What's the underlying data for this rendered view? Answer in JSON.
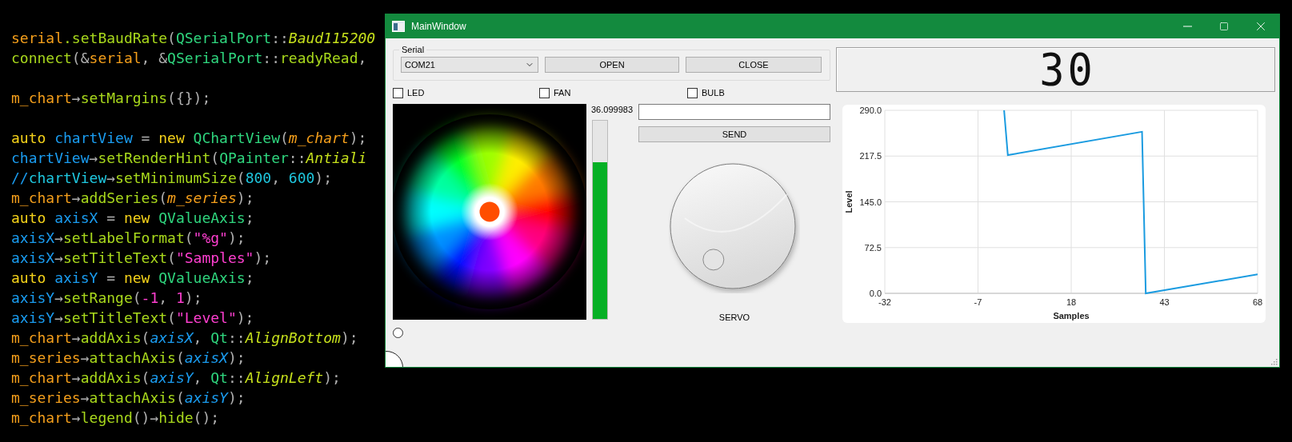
{
  "code_editor": {
    "lines": [
      {
        "kind": "code",
        "segments": [
          {
            "text": "serial",
            "color": "#f59f1b"
          },
          {
            "text": ".setBaudRate",
            "color": "#a8d81c"
          },
          {
            "text": "(",
            "color": "#b0b0b0"
          },
          {
            "text": "QSerialPort",
            "color": "#2fd67e"
          },
          {
            "text": "::",
            "color": "#b0b0b0"
          },
          {
            "text": "*Baud115200*",
            "color": "#c6e01c"
          }
        ]
      },
      {
        "kind": "code",
        "segments": [
          {
            "text": "connect",
            "color": "#a8d81c"
          },
          {
            "text": "(&",
            "color": "#b0b0b0"
          },
          {
            "text": "serial",
            "color": "#f59f1b"
          },
          {
            "text": ", &",
            "color": "#b0b0b0"
          },
          {
            "text": "QSerialPort",
            "color": "#2fd67e"
          },
          {
            "text": "::",
            "color": "#b0b0b0"
          },
          {
            "text": "readyRead",
            "color": "#a8d81c"
          },
          {
            "text": ",",
            "color": "#b0b0b0"
          }
        ]
      },
      {
        "kind": "blank"
      },
      {
        "kind": "code",
        "segments": [
          {
            "text": "m_chart",
            "color": "#f59f1b"
          },
          {
            "text": "→",
            "color": "#b0b0b0"
          },
          {
            "text": "setMargins",
            "color": "#a8d81c"
          },
          {
            "text": "({});",
            "color": "#b0b0b0"
          }
        ]
      },
      {
        "kind": "blank"
      },
      {
        "kind": "code",
        "segments": [
          {
            "text": "auto ",
            "color": "#f5d21a"
          },
          {
            "text": "chartView",
            "color": "#1a9cf0"
          },
          {
            "text": " = ",
            "color": "#b0b0b0"
          },
          {
            "text": "new ",
            "color": "#f5d21a"
          },
          {
            "text": "QChartView",
            "color": "#2fd67e"
          },
          {
            "text": "(",
            "color": "#b0b0b0"
          },
          {
            "text": "*m_chart*",
            "color": "#f59f1b"
          },
          {
            "text": ");",
            "color": "#b0b0b0"
          }
        ]
      },
      {
        "kind": "code",
        "segments": [
          {
            "text": "chartView",
            "color": "#1a9cf0"
          },
          {
            "text": "→",
            "color": "#b0b0b0"
          },
          {
            "text": "setRenderHint",
            "color": "#a8d81c"
          },
          {
            "text": "(",
            "color": "#b0b0b0"
          },
          {
            "text": "QPainter",
            "color": "#2fd67e"
          },
          {
            "text": "::",
            "color": "#b0b0b0"
          },
          {
            "text": "*Antiali*",
            "color": "#c6e01c"
          }
        ]
      },
      {
        "kind": "code",
        "segments": [
          {
            "text": "//",
            "color": "#1a9cf0"
          },
          {
            "text": "chartView",
            "color": "#1fc8e0"
          },
          {
            "text": "→",
            "color": "#b0b0b0"
          },
          {
            "text": "setMinimumSize",
            "color": "#a8d81c"
          },
          {
            "text": "(",
            "color": "#b0b0b0"
          },
          {
            "text": "800",
            "color": "#1fc8e0"
          },
          {
            "text": ", ",
            "color": "#b0b0b0"
          },
          {
            "text": "600",
            "color": "#1fc8e0"
          },
          {
            "text": ");",
            "color": "#b0b0b0"
          }
        ]
      },
      {
        "kind": "code",
        "segments": [
          {
            "text": "m_chart",
            "color": "#f59f1b"
          },
          {
            "text": "→",
            "color": "#b0b0b0"
          },
          {
            "text": "addSeries",
            "color": "#a8d81c"
          },
          {
            "text": "(",
            "color": "#b0b0b0"
          },
          {
            "text": "*m_series*",
            "color": "#f59f1b"
          },
          {
            "text": ");",
            "color": "#b0b0b0"
          }
        ]
      },
      {
        "kind": "code",
        "segments": [
          {
            "text": "auto ",
            "color": "#f5d21a"
          },
          {
            "text": "axisX",
            "color": "#1a9cf0"
          },
          {
            "text": " = ",
            "color": "#b0b0b0"
          },
          {
            "text": "new ",
            "color": "#f5d21a"
          },
          {
            "text": "QValueAxis",
            "color": "#2fd67e"
          },
          {
            "text": ";",
            "color": "#b0b0b0"
          }
        ]
      },
      {
        "kind": "code",
        "segments": [
          {
            "text": "axisX",
            "color": "#1a9cf0"
          },
          {
            "text": "→",
            "color": "#b0b0b0"
          },
          {
            "text": "setLabelFormat",
            "color": "#a8d81c"
          },
          {
            "text": "(",
            "color": "#b0b0b0"
          },
          {
            "text": "\"%g\"",
            "color": "#ff3fd0"
          },
          {
            "text": ");",
            "color": "#b0b0b0"
          }
        ]
      },
      {
        "kind": "code",
        "segments": [
          {
            "text": "axisX",
            "color": "#1a9cf0"
          },
          {
            "text": "→",
            "color": "#b0b0b0"
          },
          {
            "text": "setTitleText",
            "color": "#a8d81c"
          },
          {
            "text": "(",
            "color": "#b0b0b0"
          },
          {
            "text": "\"Samples\"",
            "color": "#ff3fd0"
          },
          {
            "text": ");",
            "color": "#b0b0b0"
          }
        ]
      },
      {
        "kind": "code",
        "segments": [
          {
            "text": "auto ",
            "color": "#f5d21a"
          },
          {
            "text": "axisY",
            "color": "#1a9cf0"
          },
          {
            "text": " = ",
            "color": "#b0b0b0"
          },
          {
            "text": "new ",
            "color": "#f5d21a"
          },
          {
            "text": "QValueAxis",
            "color": "#2fd67e"
          },
          {
            "text": ";",
            "color": "#b0b0b0"
          }
        ]
      },
      {
        "kind": "code",
        "segments": [
          {
            "text": "axisY",
            "color": "#1a9cf0"
          },
          {
            "text": "→",
            "color": "#b0b0b0"
          },
          {
            "text": "setRange",
            "color": "#a8d81c"
          },
          {
            "text": "(",
            "color": "#b0b0b0"
          },
          {
            "text": "-1",
            "color": "#ff3fd0"
          },
          {
            "text": ", ",
            "color": "#b0b0b0"
          },
          {
            "text": "1",
            "color": "#ff3fd0"
          },
          {
            "text": ");",
            "color": "#b0b0b0"
          }
        ]
      },
      {
        "kind": "code",
        "segments": [
          {
            "text": "axisY",
            "color": "#1a9cf0"
          },
          {
            "text": "→",
            "color": "#b0b0b0"
          },
          {
            "text": "setTitleText",
            "color": "#a8d81c"
          },
          {
            "text": "(",
            "color": "#b0b0b0"
          },
          {
            "text": "\"Level\"",
            "color": "#ff3fd0"
          },
          {
            "text": ");",
            "color": "#b0b0b0"
          }
        ]
      },
      {
        "kind": "code",
        "segments": [
          {
            "text": "m_chart",
            "color": "#f59f1b"
          },
          {
            "text": "→",
            "color": "#b0b0b0"
          },
          {
            "text": "addAxis",
            "color": "#a8d81c"
          },
          {
            "text": "(",
            "color": "#b0b0b0"
          },
          {
            "text": "*axisX*",
            "color": "#1a9cf0"
          },
          {
            "text": ", ",
            "color": "#b0b0b0"
          },
          {
            "text": "Qt",
            "color": "#2fd67e"
          },
          {
            "text": "::",
            "color": "#b0b0b0"
          },
          {
            "text": "*AlignBottom*",
            "color": "#c6e01c"
          },
          {
            "text": ");",
            "color": "#b0b0b0"
          }
        ]
      },
      {
        "kind": "code",
        "segments": [
          {
            "text": "m_series",
            "color": "#f59f1b"
          },
          {
            "text": "→",
            "color": "#b0b0b0"
          },
          {
            "text": "attachAxis",
            "color": "#a8d81c"
          },
          {
            "text": "(",
            "color": "#b0b0b0"
          },
          {
            "text": "*axisX*",
            "color": "#1a9cf0"
          },
          {
            "text": ");",
            "color": "#b0b0b0"
          }
        ]
      },
      {
        "kind": "code",
        "segments": [
          {
            "text": "m_chart",
            "color": "#f59f1b"
          },
          {
            "text": "→",
            "color": "#b0b0b0"
          },
          {
            "text": "addAxis",
            "color": "#a8d81c"
          },
          {
            "text": "(",
            "color": "#b0b0b0"
          },
          {
            "text": "*axisY*",
            "color": "#1a9cf0"
          },
          {
            "text": ", ",
            "color": "#b0b0b0"
          },
          {
            "text": "Qt",
            "color": "#2fd67e"
          },
          {
            "text": "::",
            "color": "#b0b0b0"
          },
          {
            "text": "*AlignLeft*",
            "color": "#c6e01c"
          },
          {
            "text": ");",
            "color": "#b0b0b0"
          }
        ]
      },
      {
        "kind": "code",
        "segments": [
          {
            "text": "m_series",
            "color": "#f59f1b"
          },
          {
            "text": "→",
            "color": "#b0b0b0"
          },
          {
            "text": "attachAxis",
            "color": "#a8d81c"
          },
          {
            "text": "(",
            "color": "#b0b0b0"
          },
          {
            "text": "*axisY*",
            "color": "#1a9cf0"
          },
          {
            "text": ");",
            "color": "#b0b0b0"
          }
        ]
      },
      {
        "kind": "code",
        "segments": [
          {
            "text": "m_chart",
            "color": "#f59f1b"
          },
          {
            "text": "→",
            "color": "#b0b0b0"
          },
          {
            "text": "legend",
            "color": "#a8d81c"
          },
          {
            "text": "()→",
            "color": "#b0b0b0"
          },
          {
            "text": "hide",
            "color": "#a8d81c"
          },
          {
            "text": "();",
            "color": "#b0b0b0"
          }
        ]
      }
    ]
  },
  "window": {
    "title": "MainWindow",
    "serial_group": {
      "title": "Serial",
      "port": {
        "value": "COM21"
      },
      "buttons": [
        "OPEN",
        "CLOSE"
      ]
    },
    "checkboxes": [
      {
        "label": "LED",
        "checked": false
      },
      {
        "label": "FAN",
        "checked": false
      },
      {
        "label": "BULB",
        "checked": false
      }
    ],
    "sensor": {
      "reading": "36.099983",
      "level": 0.79
    },
    "send_button": "SEND",
    "servo": {
      "label": "SERVO"
    },
    "radio": {
      "checked": false
    },
    "lcd": {
      "value": "30"
    },
    "chart": {
      "chart_data": {
        "type": "line",
        "grid": true,
        "xlabel": "Samples",
        "ylabel": "Level",
        "x": [
          0,
          1,
          37,
          38,
          68
        ],
        "series": [
          {
            "color": "#1a9be0",
            "values": [
              290,
              219,
              256,
              0,
              30
            ]
          }
        ],
        "xlim": [
          -32,
          68
        ],
        "ylim": [
          0,
          290
        ],
        "xticks": [
          -32,
          -7,
          18,
          43,
          68
        ],
        "yticks": [
          {
            "value": 0,
            "label": "0.0"
          },
          {
            "value": 72.5,
            "label": "72.5"
          },
          {
            "value": 145,
            "label": "145.0"
          },
          {
            "value": 217.5,
            "label": "217.5"
          },
          {
            "value": 290,
            "label": "290.0"
          }
        ]
      }
    }
  }
}
